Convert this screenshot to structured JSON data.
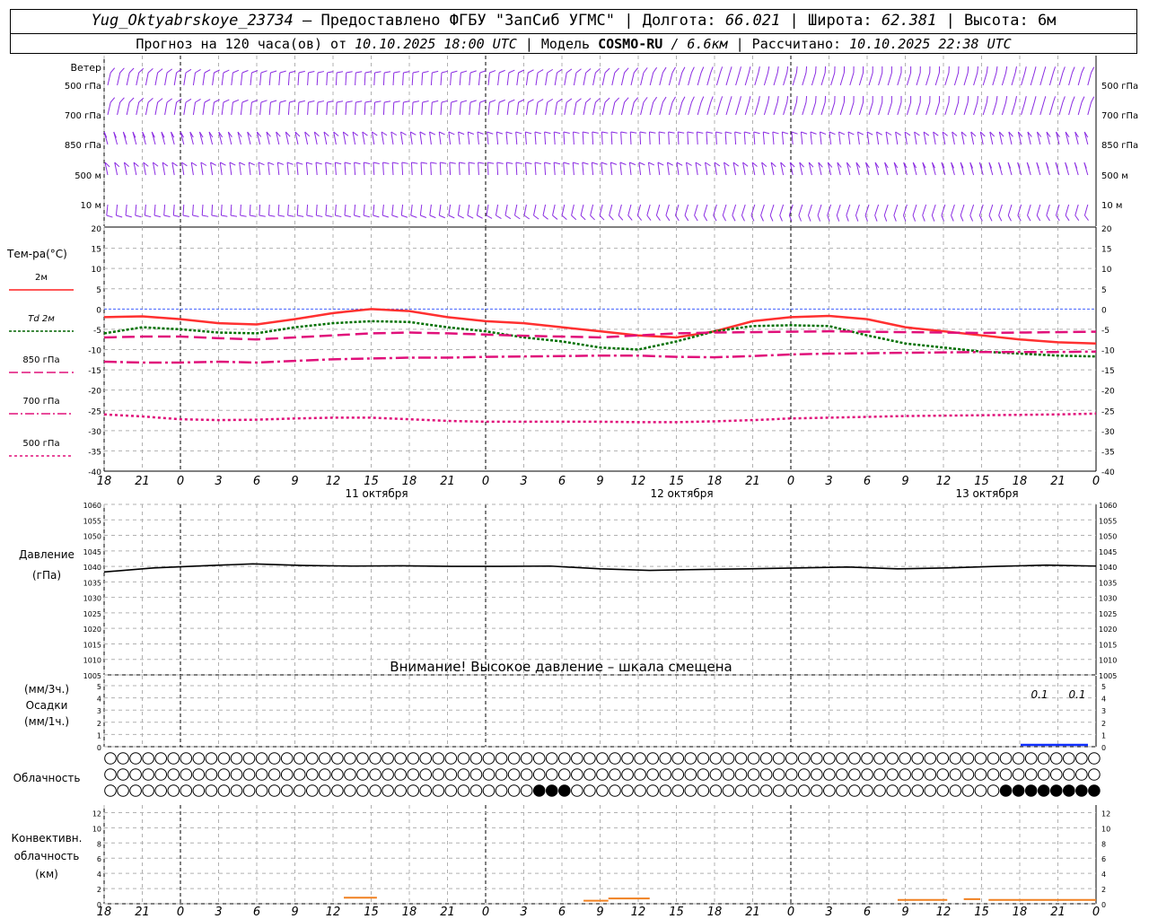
{
  "header": {
    "station": "Yug_Oktyabrskoye_23734",
    "provided": "– Предоставлено ФГБУ \"ЗапСиб УГМС\" |",
    "lon_label": "Долгота:",
    "lon": "66.021",
    "lat_label": "| Широта:",
    "lat": "62.381",
    "alt_label": "| Высота:",
    "alt": "6м",
    "forecast_label": "Прогноз на 120 часа(ов) от",
    "forecast_from": "10.10.2025 18:00 UTC",
    "model_label": "| Модель",
    "model": "COSMO-RU",
    "resolution": "/ 6.6км",
    "calc_label": "| Рассчитано:",
    "calc_time": "10.10.2025 22:38 UTC"
  },
  "panels": {
    "wind": {
      "title": "Ветер",
      "levels": [
        "500 гПа",
        "700 гПа",
        "850 гПа",
        "500 м",
        "10  м"
      ]
    },
    "temperature": {
      "title": "Тем-ра(°C)",
      "legend": [
        {
          "label": "2м",
          "color": "#ff2020",
          "style": "solid"
        },
        {
          "label": "Td  2м",
          "color": "#006400",
          "style": "dotted"
        },
        {
          "label": "850 гПа",
          "color": "#e0107a",
          "style": "dash"
        },
        {
          "label": "700 гПа",
          "color": "#e0107a",
          "style": "dashdot"
        },
        {
          "label": "500 гПа",
          "color": "#e0107a",
          "style": "dot"
        }
      ],
      "y_ticks": [
        "20",
        "15",
        "10",
        "5",
        "0",
        "-5",
        "-10",
        "-15",
        "-20",
        "-25",
        "-30",
        "-35",
        "-40"
      ]
    },
    "pressure": {
      "title_1": "Давление",
      "title_2": "(гПа)",
      "warning": "Внимание! Высокое давление – шкала смещена",
      "y_ticks": [
        "1060",
        "1055",
        "1050",
        "1045",
        "1040",
        "1035",
        "1030",
        "1025",
        "1020",
        "1015",
        "1010",
        "1005"
      ]
    },
    "precip": {
      "label_1": "(мм/3ч.)",
      "label_2": "Осадки",
      "label_3": "(мм/1ч.)",
      "y_ticks": [
        "5",
        "4",
        "3",
        "2",
        "1",
        "0"
      ],
      "annotations": [
        "0.1",
        "0.1"
      ]
    },
    "clouds": {
      "title": "Облачность"
    },
    "convective": {
      "title_1": "Конвективн.",
      "title_2": "облачность",
      "title_3": "(км)",
      "y_ticks": [
        "12",
        "10",
        "8",
        "6",
        "4",
        "2",
        "0"
      ]
    }
  },
  "x_axis": {
    "hour_labels": [
      "18",
      "21",
      "0",
      "3",
      "6",
      "9",
      "12",
      "15",
      "18",
      "21",
      "0",
      "3",
      "6",
      "9",
      "12",
      "15",
      "18",
      "21",
      "0",
      "3",
      "6",
      "9",
      "12",
      "15",
      "18",
      "21",
      "0"
    ],
    "dates": [
      "11 октября",
      "12 октября",
      "13 октября"
    ]
  },
  "colors": {
    "wind": "#8a2be2",
    "t2m": "#ff3030",
    "td2m": "#007000",
    "upper": "#e0107a",
    "pressure": "#000000",
    "precip": "#1030ff",
    "convective": "#f08020",
    "grid": "#b0b0b0"
  },
  "chart_data": [
    {
      "type": "line",
      "title": "Тем-ра(°C)",
      "x_hours_from_start": [
        0,
        3,
        6,
        9,
        12,
        15,
        18,
        21,
        24,
        27,
        30,
        33,
        36,
        39,
        42,
        45,
        48,
        51,
        54,
        57,
        60,
        63,
        66,
        69,
        72,
        75,
        78
      ],
      "ylim": [
        -40,
        20
      ],
      "series": [
        {
          "name": "2м",
          "values": [
            -2,
            -1.8,
            -2.5,
            -3.5,
            -3.8,
            -2.5,
            -1,
            0,
            -0.5,
            -2,
            -3,
            -3.5,
            -4.5,
            -5.5,
            -6.5,
            -7,
            -5.5,
            -3,
            -2,
            -1.7,
            -2.5,
            -4.5,
            -5.5,
            -6.5,
            -7.5,
            -8.2,
            -8.5
          ]
        },
        {
          "name": "Td  2м",
          "values": [
            -6,
            -4.5,
            -5,
            -5.8,
            -6,
            -4.5,
            -3.5,
            -3,
            -3.2,
            -4.5,
            -5.5,
            -7,
            -8,
            -9.5,
            -10,
            -8,
            -5.5,
            -4.2,
            -4,
            -4.2,
            -6.5,
            -8.5,
            -9.5,
            -10.5,
            -11,
            -11.5,
            -11.7
          ]
        },
        {
          "name": "850 гПа",
          "values": [
            -7,
            -6.8,
            -6.8,
            -7.2,
            -7.5,
            -7,
            -6.5,
            -6,
            -5.8,
            -6,
            -6.3,
            -6.6,
            -6.8,
            -7,
            -6.5,
            -6,
            -5.8,
            -5.7,
            -5.6,
            -5.5,
            -5.6,
            -5.7,
            -5.8,
            -5.9,
            -5.8,
            -5.7,
            -5.6
          ]
        },
        {
          "name": "700 гПа",
          "values": [
            -13,
            -13.2,
            -13.2,
            -13,
            -13.2,
            -12.8,
            -12.4,
            -12.2,
            -12,
            -12,
            -11.8,
            -11.7,
            -11.6,
            -11.5,
            -11.5,
            -11.8,
            -11.9,
            -11.6,
            -11.2,
            -11,
            -10.9,
            -10.8,
            -10.7,
            -10.6,
            -10.6,
            -10.6,
            -10.5
          ]
        },
        {
          "name": "500 гПа",
          "values": [
            -26,
            -26.5,
            -27.2,
            -27.4,
            -27.3,
            -27.0,
            -26.8,
            -26.8,
            -27.2,
            -27.6,
            -27.8,
            -27.8,
            -27.8,
            -27.8,
            -27.9,
            -27.9,
            -27.7,
            -27.4,
            -27.0,
            -26.8,
            -26.6,
            -26.4,
            -26.3,
            -26.2,
            -26.1,
            -26.0,
            -25.8
          ]
        }
      ]
    },
    {
      "type": "line",
      "title": "Давление (гПа)",
      "x_hours_from_start": [
        0,
        6,
        12,
        18,
        24,
        30,
        36,
        42,
        48,
        54,
        60,
        66,
        72,
        78,
        84,
        90,
        96,
        102,
        108,
        114,
        120
      ],
      "ylim": [
        1005,
        1060
      ],
      "series": [
        {
          "name": "Давление",
          "values": [
            1038.2,
            1039.5,
            1040.2,
            1040.8,
            1040.3,
            1040.1,
            1040.2,
            1040.0,
            1040.0,
            1040.1,
            1039.2,
            1038.7,
            1039.0,
            1039.2,
            1039.5,
            1039.8,
            1039.2,
            1039.5,
            1040.0,
            1040.4,
            1040.1
          ]
        }
      ]
    },
    {
      "type": "bar",
      "title": "Осадки",
      "ylim": [
        0,
        5
      ],
      "series": [
        {
          "name": "Осадки",
          "x_hours_from_start": [
            114,
            117
          ],
          "values": [
            0.1,
            0.1
          ]
        }
      ]
    },
    {
      "type": "bar",
      "title": "Конвективн. облачность (км)",
      "ylim": [
        0,
        12
      ],
      "series": [
        {
          "name": "Конвективн. облачность",
          "segments": [
            {
              "from": 29,
              "to": 33,
              "value": 0.8
            },
            {
              "from": 58,
              "to": 61,
              "value": 0.4
            },
            {
              "from": 61,
              "to": 66,
              "value": 0.7
            },
            {
              "from": 96,
              "to": 102,
              "value": 0.5
            },
            {
              "from": 104,
              "to": 106,
              "value": 0.6
            },
            {
              "from": 107,
              "to": 120,
              "value": 0.5
            }
          ]
        }
      ]
    }
  ]
}
